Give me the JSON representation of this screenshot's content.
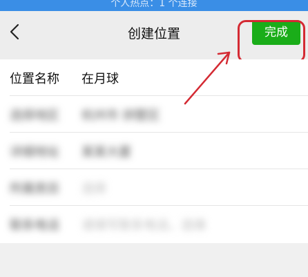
{
  "status_bar": {
    "text": "个人热点：1 个连接"
  },
  "nav": {
    "title": "创建位置",
    "done_label": "完成"
  },
  "form": {
    "rows": [
      {
        "label": "位置名称",
        "value": "在月球"
      },
      {
        "label": "选择地区",
        "value": "杭州市 拱墅区"
      },
      {
        "label": "详细地址",
        "value": "某某大厦"
      },
      {
        "label": "所属类目",
        "value": "选择"
      },
      {
        "label": "联系电话",
        "value": "请填写联系电话，选填"
      }
    ]
  },
  "colors": {
    "accent_green": "#1aad19",
    "annotation_red": "#d42a33",
    "status_blue": "#3a8ee6"
  }
}
